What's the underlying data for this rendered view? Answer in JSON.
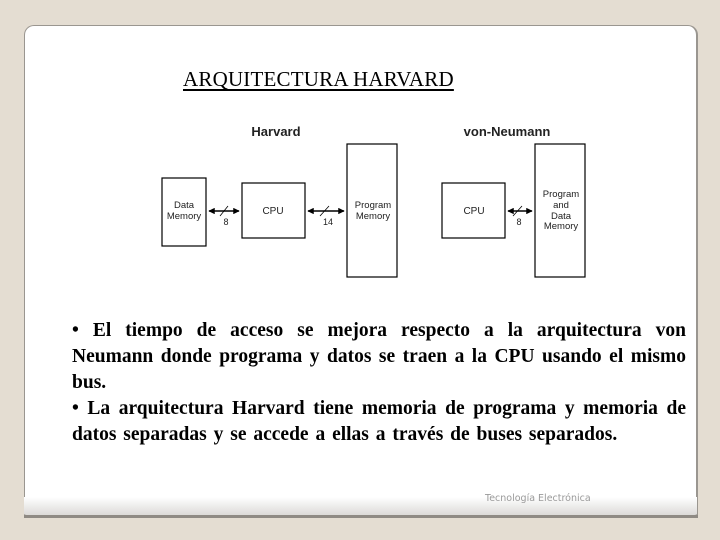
{
  "slide": {
    "title": "ARQUITECTURA HARVARD",
    "footer": "Tecnología Electrónica"
  },
  "diagram": {
    "harvard": {
      "label": "Harvard",
      "data_memory": [
        "Data",
        "Memory"
      ],
      "cpu": "CPU",
      "program_memory": [
        "Program",
        "Memory"
      ],
      "bus_data_width": "8",
      "bus_program_width": "14"
    },
    "von_neumann": {
      "label": "von-Neumann",
      "cpu": "CPU",
      "memory": [
        "Program",
        "and",
        "Data",
        "Memory"
      ],
      "bus_width": "8"
    }
  },
  "bullets": [
    "• El tiempo de acceso se mejora respecto a la arquitectura von Neumann donde programa y datos se traen a la CPU usando el mismo bus.",
    "• La arquitectura Harvard tiene memoria de programa y memoria de datos separadas y se accede a ellas a través de buses separados."
  ]
}
